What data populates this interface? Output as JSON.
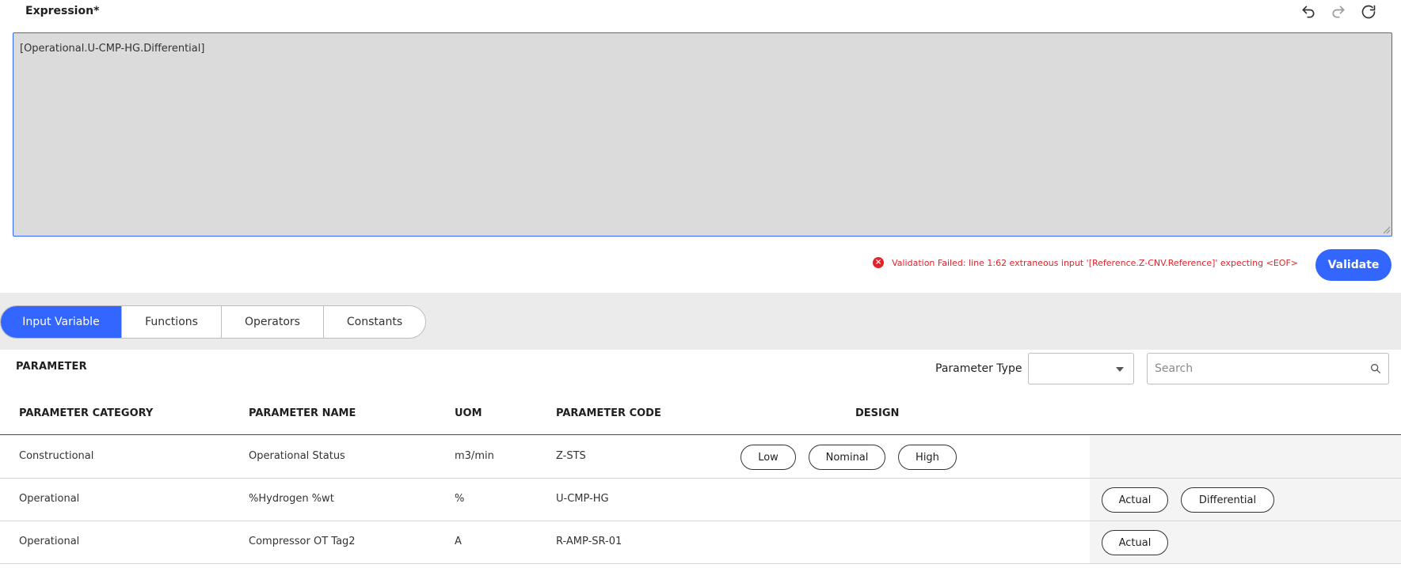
{
  "expression": {
    "title": "Expression*",
    "value": "[Operational.U-CMP-HG.Differential]",
    "validation_message": "Validation Failed: line 1:62 extraneous input '[Reference.Z-CNV.Reference]' expecting <EOF>",
    "validate_label": "Validate"
  },
  "tabs": [
    {
      "label": "Input Variable",
      "active": true
    },
    {
      "label": "Functions",
      "active": false
    },
    {
      "label": "Operators",
      "active": false
    },
    {
      "label": "Constants",
      "active": false
    }
  ],
  "parameter": {
    "title": "PARAMETER",
    "type_label": "Parameter Type",
    "type_value": "",
    "search_placeholder": "Search"
  },
  "table": {
    "headers": [
      "PARAMETER CATEGORY",
      "PARAMETER NAME",
      "UOM",
      "PARAMETER CODE",
      "DESIGN"
    ],
    "rows": [
      {
        "category": "Constructional",
        "name": "Operational Status",
        "uom": "m3/min",
        "code": "Z-STS",
        "design": [
          "Low",
          "Nominal",
          "High"
        ],
        "values": []
      },
      {
        "category": "Operational",
        "name": "%Hydrogen %wt",
        "uom": "%",
        "code": "U-CMP-HG",
        "design": [],
        "values": [
          "Actual",
          "Differential"
        ]
      },
      {
        "category": "Operational",
        "name": "Compressor OT Tag2",
        "uom": "A",
        "code": "R-AMP-SR-01",
        "design": [],
        "values": [
          "Actual"
        ]
      }
    ]
  },
  "colors": {
    "accent": "#3366ff",
    "error": "#e0242b",
    "editor_bg": "#dbdbdb",
    "band_bg": "#ebebeb"
  }
}
